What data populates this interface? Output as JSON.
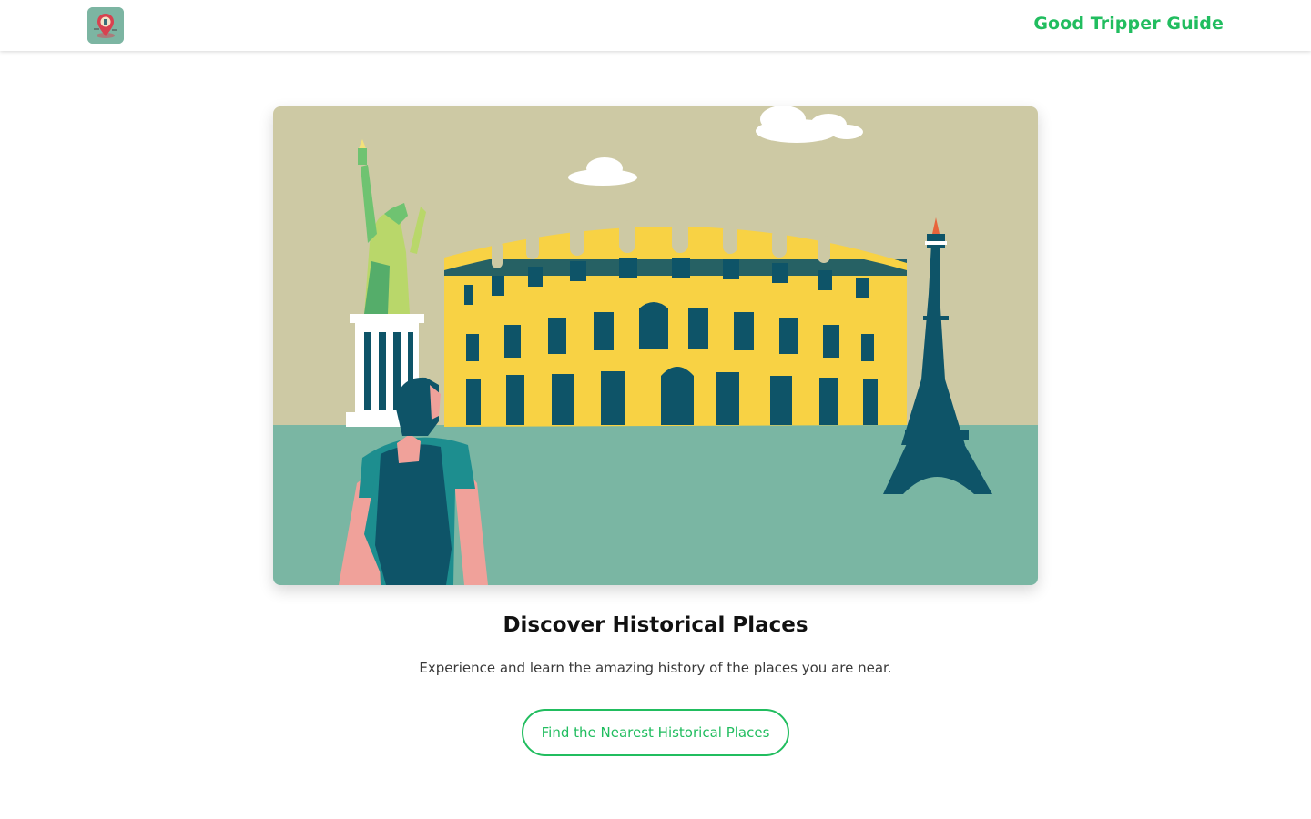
{
  "navbar": {
    "logo_icon": "map-pin-logo-icon",
    "brand": "Good Tripper Guide",
    "brand_color": "#21bd5f"
  },
  "hero": {
    "illustration": "traveler-viewing-landmarks",
    "colors": {
      "sky": "#cdc9a4",
      "ground": "#7ab6a3",
      "colosseum": "#f8d244",
      "dark_teal": "#0e5468",
      "statue_green": "#6fc371"
    }
  },
  "content": {
    "title": "Discover Historical Places",
    "subtitle": "Experience and learn the amazing history of the places you are near.",
    "cta_label": "Find the Nearest Historical Places"
  }
}
